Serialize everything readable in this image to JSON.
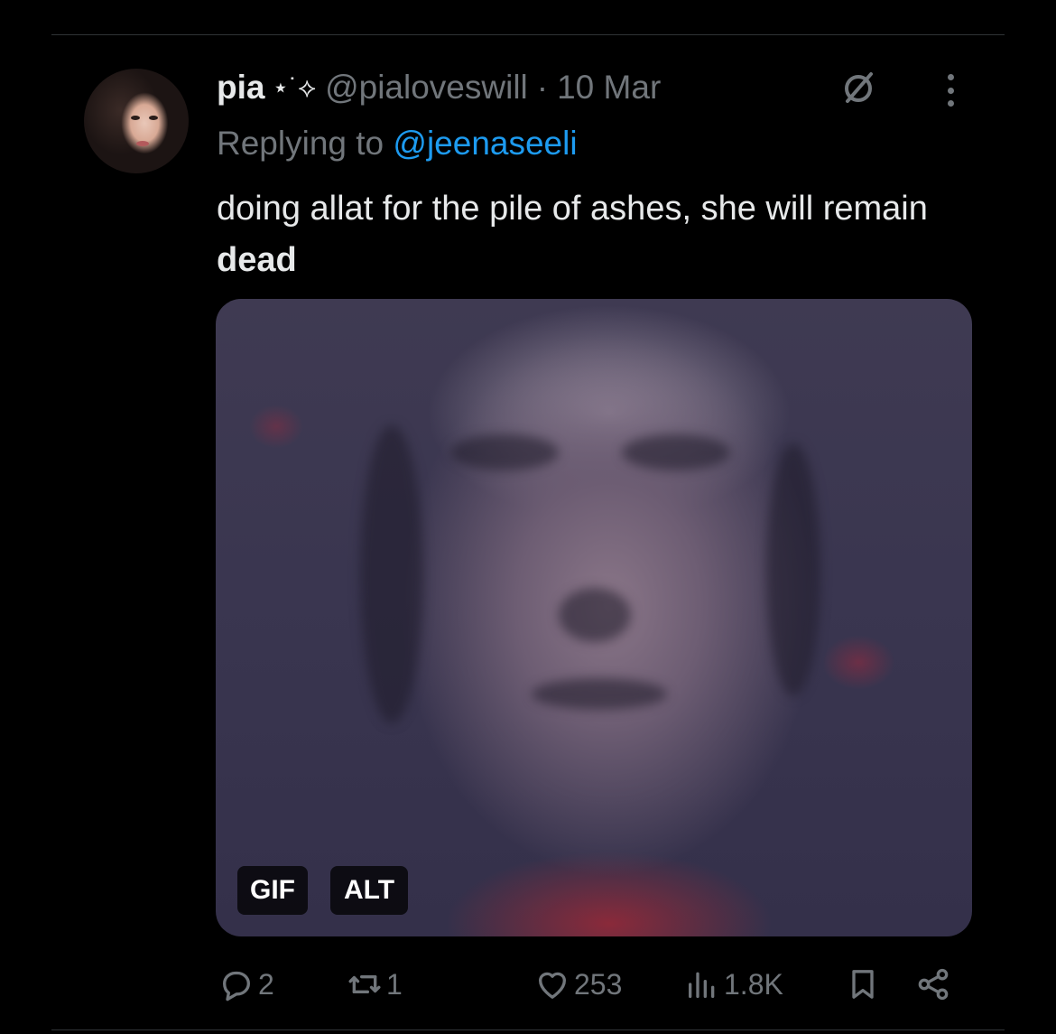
{
  "tweet": {
    "author_name": "pia",
    "name_decoration": "⋆˙⟡",
    "handle": "@pialoveswill",
    "separator": "·",
    "date": "10 Mar",
    "replying_prefix": "Replying to",
    "replying_to": "@jeenaseeli",
    "text_plain": "doing allat for the pile of ashes, she will remain",
    "text_bold": "dead"
  },
  "media": {
    "gif_badge": "GIF",
    "alt_badge": "ALT"
  },
  "actions": {
    "replies": "2",
    "reposts": "1",
    "likes": "253",
    "views": "1.8K"
  },
  "colors": {
    "background": "#000000",
    "text_primary": "#e7e9ea",
    "text_secondary": "#71767b",
    "link": "#1d9bf0"
  },
  "icons": {
    "grok": "grok-icon",
    "more": "more-dots-icon",
    "reply": "reply-bubble-icon",
    "repost": "repost-icon",
    "like": "heart-icon",
    "views": "views-bars-icon",
    "bookmark": "bookmark-icon",
    "share": "share-icon"
  }
}
